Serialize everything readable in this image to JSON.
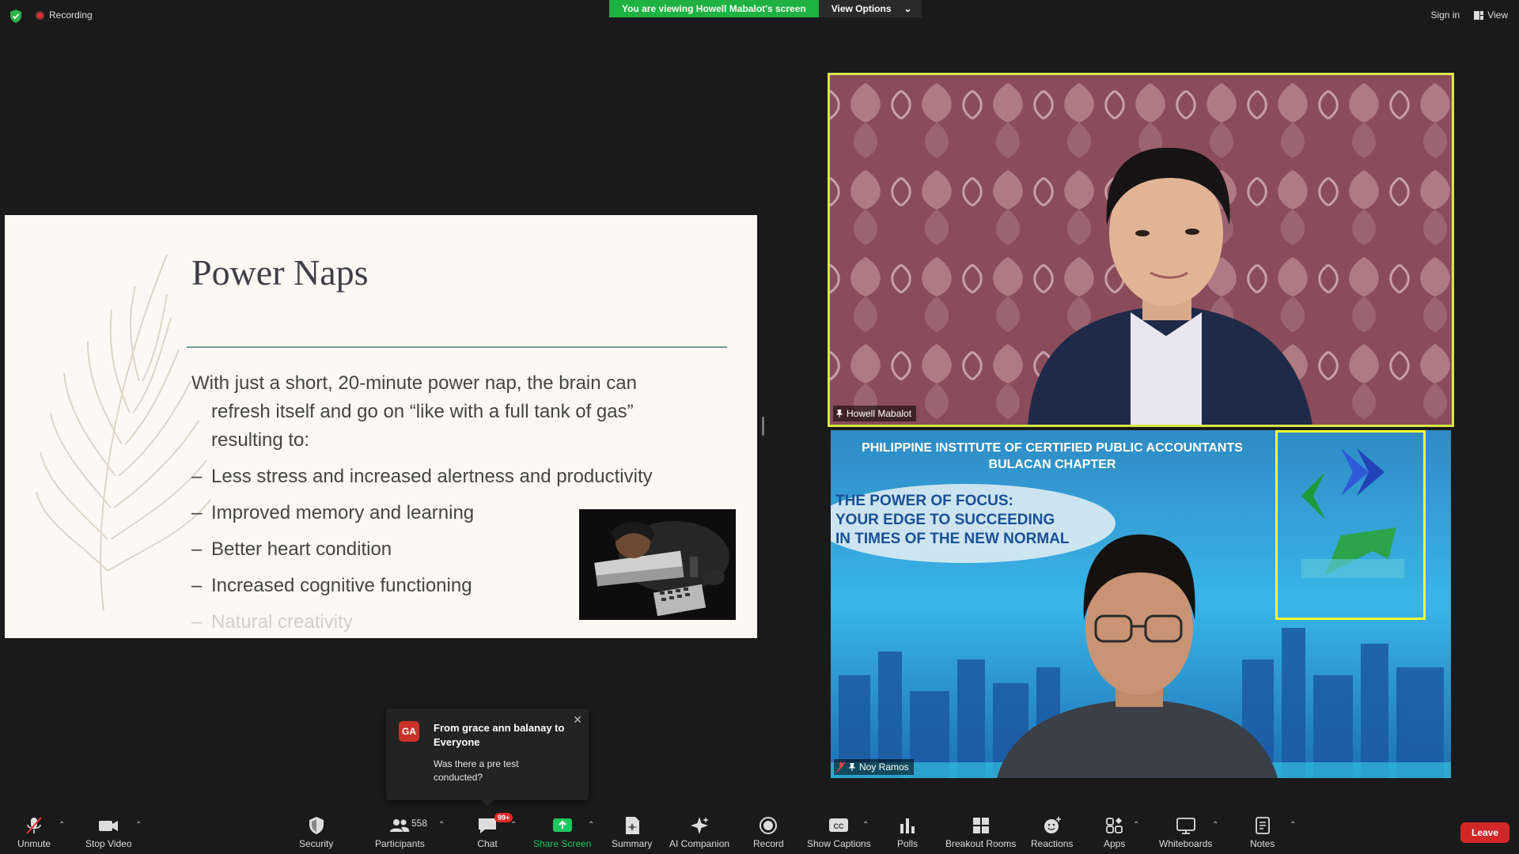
{
  "topbar": {
    "recording_label": "Recording",
    "viewing_banner": "You are viewing Howell Mabalot's screen",
    "view_options_label": "View Options",
    "sign_in_label": "Sign in",
    "view_label": "View"
  },
  "slide": {
    "title": "Power Naps",
    "intro": "With just a short, 20-minute power nap, the brain can refresh itself and go on “like with a full tank of gas” resulting to:",
    "bullets": [
      "Less stress and increased alertness and productivity",
      "Improved memory and learning",
      "Better heart condition",
      "Increased cognitive functioning",
      "Natural creativity"
    ]
  },
  "tiles": {
    "speaker_name": "Howell Mabalot",
    "participant_name": "Noy Ramos",
    "banner_line1": "PHILIPPINE INSTITUTE OF CERTIFIED PUBLIC ACCOUNTANTS",
    "banner_line2": "BULACAN CHAPTER",
    "focus_line1": "THE POWER OF FOCUS:",
    "focus_line2": "YOUR EDGE TO SUCCEEDING",
    "focus_line3": "IN TIMES OF THE NEW NORMAL",
    "accent_color": "#d6e84a"
  },
  "chat_popup": {
    "avatar_initials": "GA",
    "from": "From grace ann balanay to Everyone",
    "message": "Was there a pre test conducted?"
  },
  "toolbar": {
    "unmute": "Unmute",
    "stop_video": "Stop Video",
    "security": "Security",
    "participants": "Participants",
    "participant_count": "558",
    "chat": "Chat",
    "chat_badge": "99+",
    "share_screen": "Share Screen",
    "summary": "Summary",
    "ai_companion": "AI Companion",
    "record": "Record",
    "show_captions": "Show Captions",
    "polls": "Polls",
    "breakout_rooms": "Breakout Rooms",
    "reactions": "Reactions",
    "apps": "Apps",
    "whiteboards": "Whiteboards",
    "notes": "Notes",
    "leave": "Leave"
  }
}
